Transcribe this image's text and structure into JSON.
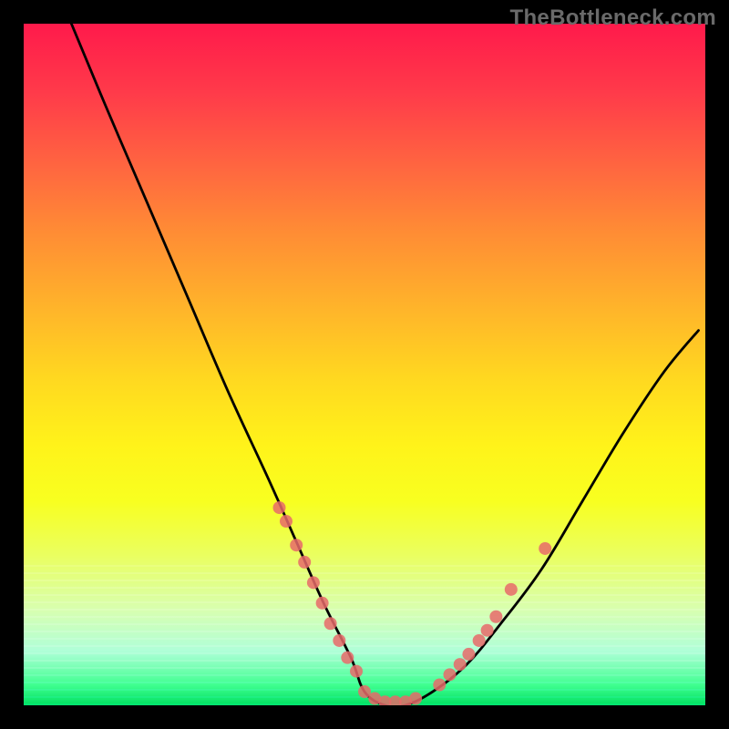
{
  "watermark": "TheBottleneck.com",
  "chart_data": {
    "type": "line",
    "title": "",
    "xlabel": "",
    "ylabel": "",
    "xlim": [
      0,
      100
    ],
    "ylim": [
      0,
      100
    ],
    "grid": false,
    "series": [
      {
        "name": "curve",
        "x": [
          7,
          12,
          18,
          24,
          30,
          36,
          40,
          44,
          48,
          50,
          53,
          56,
          60,
          65,
          70,
          76,
          82,
          88,
          94,
          99
        ],
        "y": [
          100,
          88,
          74,
          60,
          46,
          33,
          24,
          15,
          7,
          2,
          0,
          0,
          2,
          6,
          12,
          20,
          30,
          40,
          49,
          55
        ]
      },
      {
        "name": "dots-left",
        "x": [
          37.5,
          38.5,
          40.0,
          41.2,
          42.5,
          43.8,
          45.0,
          46.3,
          47.5,
          48.8
        ],
        "y": [
          29.0,
          27.0,
          23.5,
          21.0,
          18.0,
          15.0,
          12.0,
          9.5,
          7.0,
          5.0
        ]
      },
      {
        "name": "dots-bottom",
        "x": [
          50.0,
          51.5,
          53.0,
          54.5,
          56.0,
          57.5
        ],
        "y": [
          2.0,
          1.0,
          0.5,
          0.5,
          0.5,
          1.0
        ]
      },
      {
        "name": "dots-right",
        "x": [
          61.0,
          62.5,
          64.0,
          65.3,
          66.8,
          68.0,
          69.3,
          71.5
        ],
        "y": [
          3.0,
          4.5,
          6.0,
          7.5,
          9.5,
          11.0,
          13.0,
          17.0
        ]
      },
      {
        "name": "dot-right-upper",
        "x": [
          76.5
        ],
        "y": [
          23.0
        ]
      }
    ],
    "legend": false,
    "colors": {
      "curve": "#000000",
      "dots": "#e86a6a",
      "gradient_top": "#ff1a4b",
      "gradient_mid": "#fff31a",
      "gradient_bottom": "#00e060",
      "background": "#000000"
    }
  }
}
